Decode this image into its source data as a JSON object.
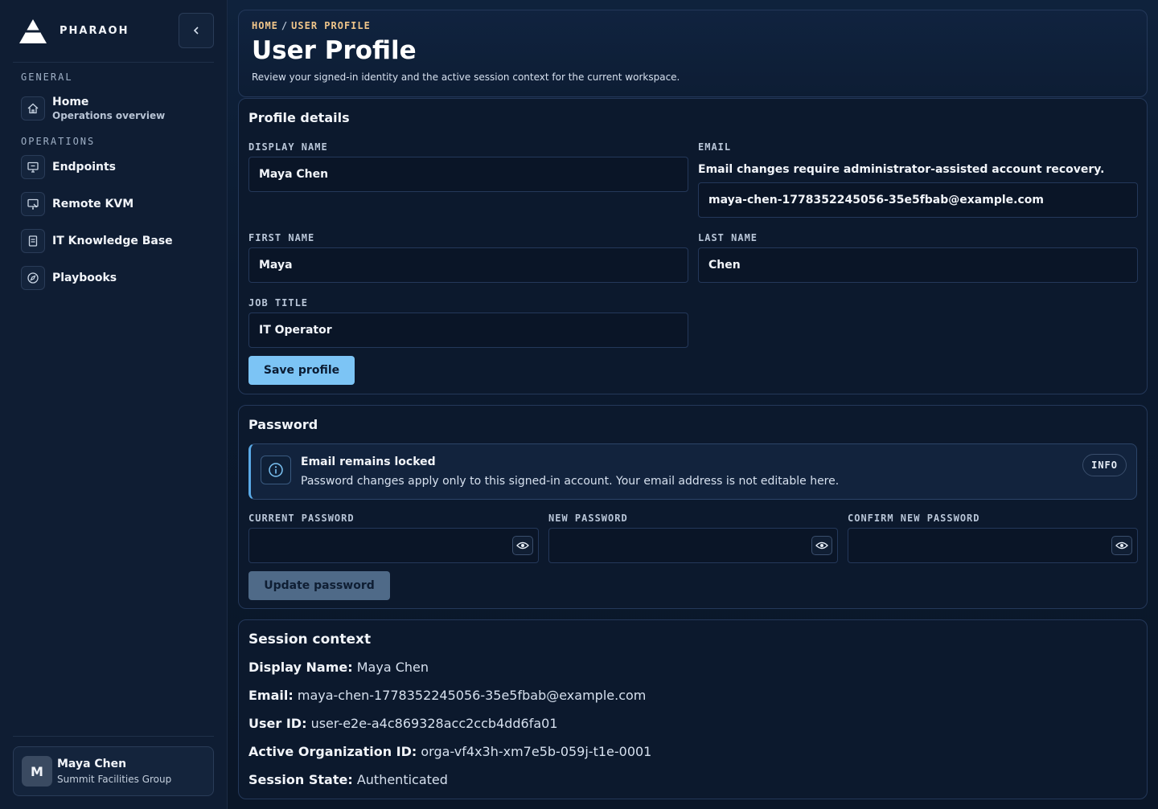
{
  "brand": {
    "name": "PHARAOH"
  },
  "sidebar": {
    "sections": [
      {
        "label": "GENERAL",
        "items": [
          {
            "label": "Home",
            "sublabel": "Operations overview",
            "icon": "home-icon"
          }
        ]
      },
      {
        "label": "OPERATIONS",
        "items": [
          {
            "label": "Endpoints",
            "icon": "monitor-icon"
          },
          {
            "label": "Remote KVM",
            "icon": "remote-screen-icon"
          },
          {
            "label": "IT Knowledge Base",
            "icon": "book-icon"
          },
          {
            "label": "Playbooks",
            "icon": "compass-icon"
          }
        ]
      }
    ],
    "user": {
      "initial": "M",
      "name": "Maya Chen",
      "org": "Summit Facilities Group"
    }
  },
  "header": {
    "breadcrumb": [
      "HOME",
      "USER PROFILE"
    ],
    "breadcrumb_separator": "/",
    "title": "User Profile",
    "subtitle": "Review your signed-in identity and the active session context for the current workspace."
  },
  "profile": {
    "title": "Profile details",
    "display_name_label": "DISPLAY NAME",
    "display_name": "Maya Chen",
    "email_label": "EMAIL",
    "email_note": "Email changes require administrator-assisted account recovery.",
    "email": "maya-chen-1778352245056-35e5fbab@example.com",
    "first_name_label": "FIRST NAME",
    "first_name": "Maya",
    "last_name_label": "LAST NAME",
    "last_name": "Chen",
    "job_title_label": "JOB TITLE",
    "job_title": "IT Operator",
    "save_label": "Save profile"
  },
  "password": {
    "title": "Password",
    "alert": {
      "title": "Email remains locked",
      "text": "Password changes apply only to this signed-in account. Your email address is not editable here.",
      "badge": "INFO"
    },
    "current_label": "CURRENT PASSWORD",
    "new_label": "NEW PASSWORD",
    "confirm_label": "CONFIRM NEW PASSWORD",
    "current_value": "",
    "new_value": "",
    "confirm_value": "",
    "update_label": "Update password"
  },
  "session": {
    "title": "Session context",
    "rows": [
      {
        "key": "Display Name:",
        "value": "Maya Chen"
      },
      {
        "key": "Email:",
        "value": "maya-chen-1778352245056-35e5fbab@example.com"
      },
      {
        "key": "User ID:",
        "value": "user-e2e-a4c869328acc2ccb4dd6fa01"
      },
      {
        "key": "Active Organization ID:",
        "value": "orga-vf4x3h-xm7e5b-059j-t1e-0001"
      },
      {
        "key": "Session State:",
        "value": "Authenticated"
      }
    ]
  },
  "colors": {
    "accent": "#7cc4f5",
    "breadcrumb": "#f0c58a",
    "background": "#0b1628"
  }
}
